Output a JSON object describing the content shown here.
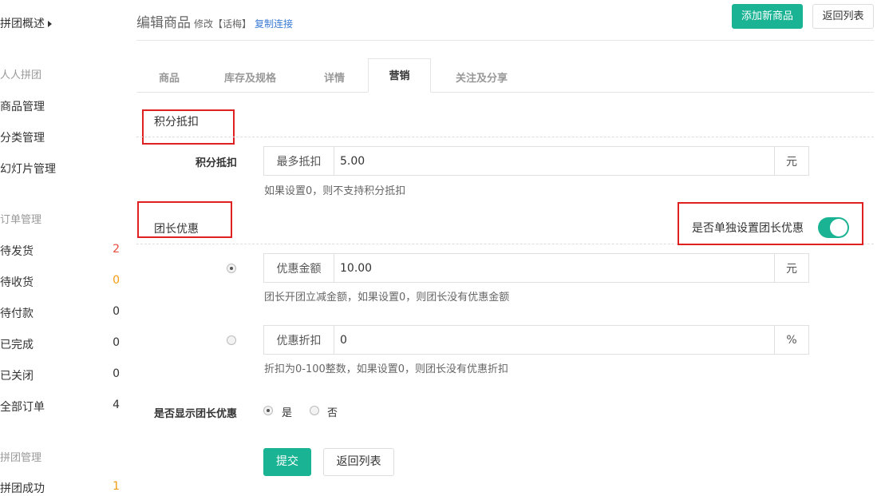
{
  "sidebar": {
    "top": "拼团概述",
    "groups": [
      {
        "label": "人人拼团",
        "items": [
          {
            "label": "商品管理"
          },
          {
            "label": "分类管理"
          },
          {
            "label": "幻灯片管理"
          }
        ]
      },
      {
        "label": "订单管理",
        "items": [
          {
            "label": "待发货",
            "count": "2"
          },
          {
            "label": "待收货",
            "count": "0"
          },
          {
            "label": "待付款",
            "count": "0"
          },
          {
            "label": "已完成",
            "count": "0"
          },
          {
            "label": "已关闭",
            "count": "0"
          },
          {
            "label": "全部订单",
            "count": "4"
          }
        ]
      },
      {
        "label": "拼团管理",
        "items": [
          {
            "label": "拼团成功",
            "count": "1"
          }
        ]
      }
    ]
  },
  "header": {
    "title": "编辑商品",
    "subtitle": "修改【话梅】",
    "copy_link": "复制连接",
    "add_button": "添加新商品",
    "back_button": "返回列表"
  },
  "tabs": [
    {
      "label": "商品"
    },
    {
      "label": "库存及规格"
    },
    {
      "label": "详情"
    },
    {
      "label": "营销"
    },
    {
      "label": "关注及分享"
    }
  ],
  "points": {
    "section_title": "积分抵扣",
    "label": "积分抵扣",
    "addon": "最多抵扣",
    "value": "5.00",
    "suffix": "元",
    "help": "如果设置0，则不支持积分抵扣"
  },
  "leader": {
    "section_title": "团长优惠",
    "toggle_label": "是否单独设置团长优惠",
    "toggle_on": true,
    "amount": {
      "addon": "优惠金额",
      "value": "10.00",
      "suffix": "元",
      "help": "团长开团立减金额，如果设置0，则团长没有优惠金额"
    },
    "discount": {
      "addon": "优惠折扣",
      "value": "0",
      "suffix": "%",
      "help": "折扣为0-100整数，如果设置0，则团长没有优惠折扣"
    },
    "show_label": "是否显示团长优惠",
    "show_yes": "是",
    "show_no": "否"
  },
  "footer": {
    "submit": "提交",
    "back": "返回列表"
  },
  "colors": {
    "accent": "#1ab394",
    "highlight_box": "#e02020",
    "count_red": "#e74c3c",
    "count_orange": "#f39c12"
  }
}
